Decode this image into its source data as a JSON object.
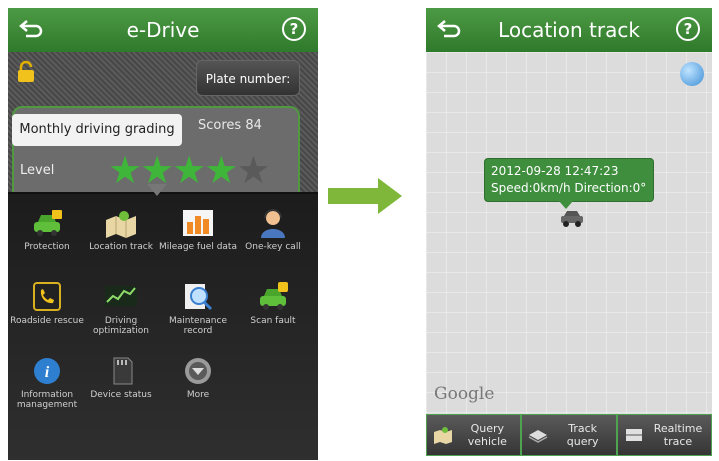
{
  "left": {
    "title": "e-Drive",
    "help": "?",
    "plate_label": "Plate number:",
    "grading_label": "Monthly driving grading",
    "scores_text": "Scores  84",
    "level_label": "Level",
    "stars_filled": 4,
    "stars_total": 5,
    "menu": [
      {
        "label": "Protection",
        "icon": "car-lock-icon"
      },
      {
        "label": "Location track",
        "icon": "map-location-icon"
      },
      {
        "label": "Mileage fuel data",
        "icon": "bar-chart-icon"
      },
      {
        "label": "One-key call",
        "icon": "operator-icon"
      },
      {
        "label": "Roadside rescue",
        "icon": "phone-icon"
      },
      {
        "label": "Driving optimization",
        "icon": "graph-icon"
      },
      {
        "label": "Maintenance record",
        "icon": "magnifier-icon"
      },
      {
        "label": "Scan fault",
        "icon": "car-alert-icon"
      },
      {
        "label": "Information management",
        "icon": "info-icon"
      },
      {
        "label": "Device status",
        "icon": "sd-card-icon"
      },
      {
        "label": "More",
        "icon": "more-icon"
      }
    ]
  },
  "right": {
    "title": "Location track",
    "help": "?",
    "callout_line1": "2012-09-28 12:47:23",
    "callout_line2": "Speed:0km/h Direction:0°",
    "map_watermark": "Google",
    "buttons": [
      {
        "label": "Query vehicle",
        "icon": "map-icon"
      },
      {
        "label": "Track query",
        "icon": "track-icon"
      },
      {
        "label": "Realtime trace",
        "icon": "trace-icon"
      }
    ]
  },
  "colors": {
    "accent_green": "#3e8e3e",
    "star_green": "#3fb53a",
    "star_empty": "#5a5a5a"
  }
}
